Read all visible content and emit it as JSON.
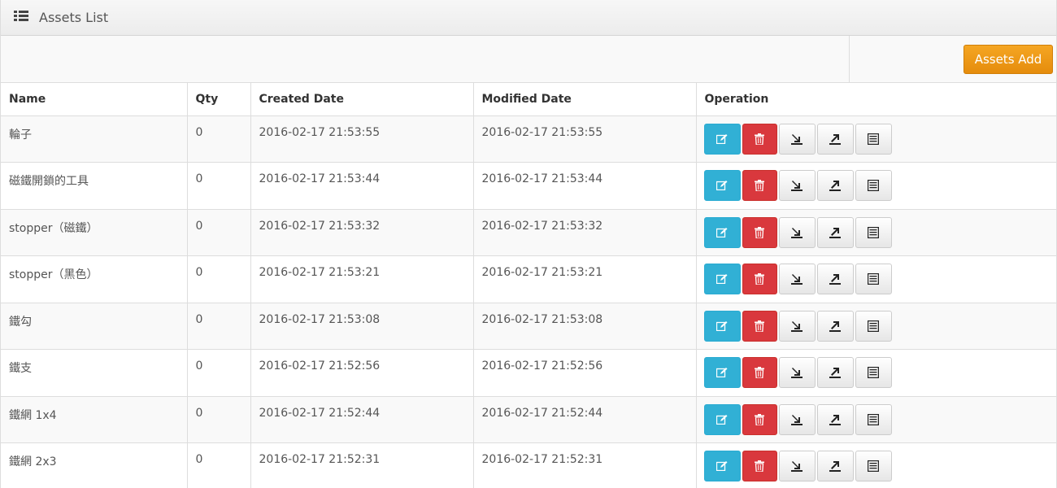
{
  "header": {
    "title": "Assets List",
    "icon": "list-icon"
  },
  "toolbar": {
    "add_label": "Assets Add"
  },
  "table": {
    "columns": [
      "Name",
      "Qty",
      "Created Date",
      "Modified Date",
      "Operation"
    ],
    "rows": [
      {
        "name": "輪子",
        "qty": "0",
        "created": "2016-02-17 21:53:55",
        "modified": "2016-02-17 21:53:55"
      },
      {
        "name": "磁鐵開鎖的工具",
        "qty": "0",
        "created": "2016-02-17 21:53:44",
        "modified": "2016-02-17 21:53:44"
      },
      {
        "name": "stopper（磁鐵）",
        "qty": "0",
        "created": "2016-02-17 21:53:32",
        "modified": "2016-02-17 21:53:32"
      },
      {
        "name": "stopper（黑色）",
        "qty": "0",
        "created": "2016-02-17 21:53:21",
        "modified": "2016-02-17 21:53:21"
      },
      {
        "name": "鐵勾",
        "qty": "0",
        "created": "2016-02-17 21:53:08",
        "modified": "2016-02-17 21:53:08"
      },
      {
        "name": "鐵支",
        "qty": "0",
        "created": "2016-02-17 21:52:56",
        "modified": "2016-02-17 21:52:56"
      },
      {
        "name": "鐵網 1x4",
        "qty": "0",
        "created": "2016-02-17 21:52:44",
        "modified": "2016-02-17 21:52:44"
      },
      {
        "name": "鐵網 2x3",
        "qty": "0",
        "created": "2016-02-17 21:52:31",
        "modified": "2016-02-17 21:52:31"
      }
    ],
    "operation_icons": [
      "edit-icon",
      "trash-icon",
      "import-icon",
      "export-icon",
      "list-detail-icon"
    ]
  },
  "colors": {
    "edit": "#31b0d5",
    "delete": "#d9383d",
    "add": "#f0960f"
  }
}
